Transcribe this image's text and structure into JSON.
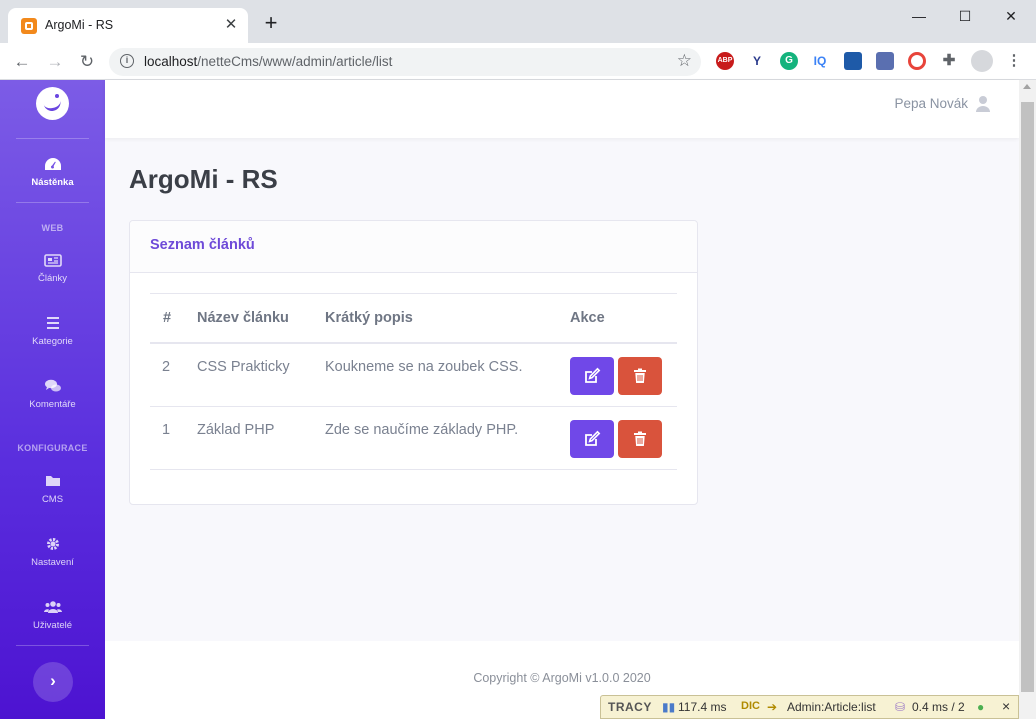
{
  "browser": {
    "tab_title": "ArgoMi - RS",
    "tab_close": "✕",
    "new_tab": "+",
    "url_host": "localhost",
    "url_path": "/netteCms/www/admin/article/list",
    "window_minimize": "—",
    "window_maximize": "☐",
    "window_close": "✕",
    "extensions": [
      "ABP",
      "Y",
      "G",
      "IQ"
    ]
  },
  "sidebar": {
    "items": [
      {
        "label": "Nástěnka",
        "icon": "dashboard-icon",
        "active": true
      },
      {
        "label": "Články",
        "icon": "newspaper-icon"
      },
      {
        "label": "Kategorie",
        "icon": "list-icon"
      },
      {
        "label": "Komentáře",
        "icon": "comments-icon"
      },
      {
        "label": "CMS",
        "icon": "folder-icon"
      },
      {
        "label": "Nastavení",
        "icon": "gear-icon"
      },
      {
        "label": "Uživatelé",
        "icon": "users-icon"
      }
    ],
    "headings": {
      "web": "WEB",
      "config": "KONFIGURACE"
    },
    "toggle": "›"
  },
  "header": {
    "user_name": "Pepa Novák"
  },
  "page": {
    "title": "ArgoMi - RS"
  },
  "card": {
    "title": "Seznam článků",
    "columns": [
      "#",
      "Název článku",
      "Krátký popis",
      "Akce"
    ],
    "rows": [
      {
        "id": "2",
        "name": "CSS Prakticky",
        "desc": "Koukneme se na zoubek CSS."
      },
      {
        "id": "1",
        "name": "Základ PHP",
        "desc": "Zde se naučíme základy PHP."
      }
    ]
  },
  "footer": {
    "copyright": "Copyright © ArgoMi v1.0.0 2020"
  },
  "tracy": {
    "label": "TRACY",
    "time": "117.4 ms",
    "di": "DIC",
    "route": "Admin:Article:list",
    "db": "0.4 ms / 2",
    "close": "×"
  },
  "colors": {
    "accent": "#6e4ad8",
    "edit_button": "#7048e8",
    "delete_button": "#d9533c"
  }
}
